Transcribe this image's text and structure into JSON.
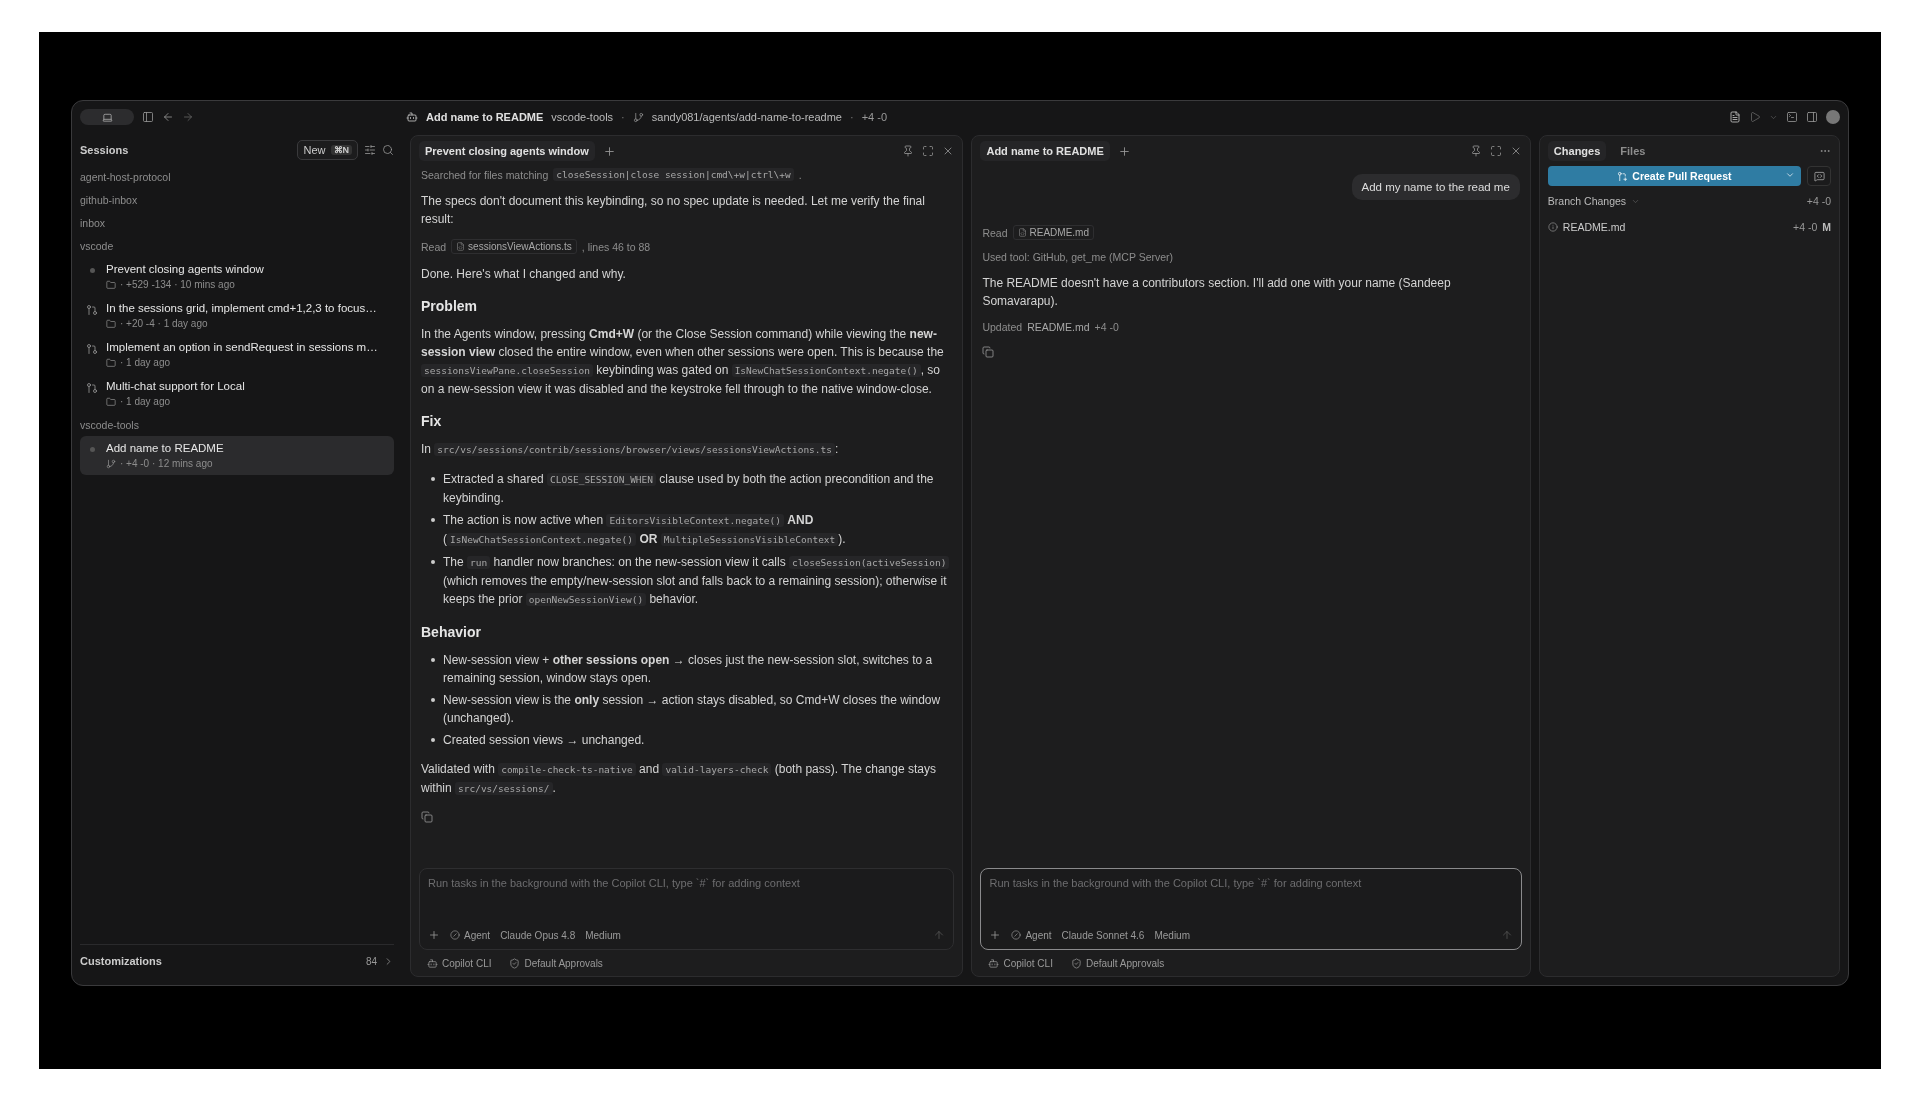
{
  "titlebar": {
    "title": "Add name to README",
    "repo": "vscode-tools",
    "separator_1": "·",
    "branch": "sandy081/agents/add-name-to-readme",
    "separator_2": "·",
    "diff": "+4 -0"
  },
  "sidebar": {
    "title": "Sessions",
    "new_button": {
      "label": "New",
      "shortcut": "⌘N"
    },
    "groups": [
      {
        "name": "agent-host-protocol"
      },
      {
        "name": "github-inbox"
      },
      {
        "name": "inbox"
      },
      {
        "name": "vscode",
        "items": [
          {
            "kind": "dot",
            "title": "Prevent closing agents window",
            "meta": {
              "kind": "folder",
              "text": "· +529 -134 · 10 mins ago"
            },
            "selected": false
          },
          {
            "kind": "pr",
            "title": "In the sessions grid, implement cmd+1,2,3 to focus…",
            "meta": {
              "kind": "folder",
              "text": "· +20 -4 · 1 day ago"
            },
            "selected": false
          },
          {
            "kind": "pr",
            "title": "Implement an option in sendRequest in sessions m…",
            "meta": {
              "kind": "folder",
              "text": "· 1 day ago"
            },
            "selected": false
          },
          {
            "kind": "pr",
            "title": "Multi-chat support for Local",
            "meta": {
              "kind": "folder",
              "text": "· 1 day ago"
            },
            "selected": false
          }
        ]
      },
      {
        "name": "vscode-tools",
        "items": [
          {
            "kind": "dot",
            "title": "Add name to README",
            "meta": {
              "kind": "branch",
              "text": "· +4 -0 · 12 mins ago"
            },
            "selected": true
          }
        ]
      }
    ],
    "footer": {
      "label": "Customizations",
      "count": "84"
    }
  },
  "chats": [
    {
      "tab": "Prevent closing agents window",
      "messages": [
        {
          "kind": "tool",
          "segments": [
            {
              "kind": "text",
              "text": "Searched for files matching"
            },
            {
              "kind": "code",
              "text": "closeSession|close session|cmd\\+w|ctrl\\+w"
            },
            {
              "kind": "text",
              "text": "."
            }
          ]
        },
        {
          "kind": "para",
          "segments": [
            {
              "kind": "text",
              "text": "The specs don't document this keybinding, so no spec update is needed. Let me verify the final result:"
            }
          ]
        },
        {
          "kind": "tool",
          "segments": [
            {
              "kind": "text",
              "text": "Read"
            },
            {
              "kind": "file",
              "text": "sessionsViewActions.ts"
            },
            {
              "kind": "text",
              "text": ", lines 46 to 88"
            }
          ]
        },
        {
          "kind": "para",
          "segments": [
            {
              "kind": "text",
              "text": "Done. Here's what I changed and why."
            }
          ]
        },
        {
          "kind": "heading",
          "text": "Problem"
        },
        {
          "kind": "para",
          "segments": [
            {
              "kind": "text",
              "text": "In the Agents window, pressing **Cmd+W** (or the Close Session command) while viewing the **new-session view** closed the entire window, even when other sessions were open. This is because the "
            },
            {
              "kind": "code",
              "text": "sessionsViewPane.closeSession"
            },
            {
              "kind": "text",
              "text": " keybinding was gated on "
            },
            {
              "kind": "code",
              "text": "IsNewChatSessionContext.negate()"
            },
            {
              "kind": "text",
              "text": ", so on a new-session view it was disabled and the keystroke fell through to the native window-close."
            }
          ]
        },
        {
          "kind": "heading",
          "text": "Fix"
        },
        {
          "kind": "para",
          "segments": [
            {
              "kind": "text",
              "text": "In "
            },
            {
              "kind": "code",
              "text": "src/vs/sessions/contrib/sessions/browser/views/sessionsViewActions.ts"
            },
            {
              "kind": "text",
              "text": ":"
            }
          ]
        },
        {
          "kind": "list",
          "items": [
            [
              {
                "kind": "text",
                "text": "Extracted a shared "
              },
              {
                "kind": "code",
                "text": "CLOSE_SESSION_WHEN"
              },
              {
                "kind": "text",
                "text": " clause used by both the action precondition and the keybinding."
              }
            ],
            [
              {
                "kind": "text",
                "text": "The action is now active when "
              },
              {
                "kind": "code",
                "text": "EditorsVisibleContext.negate()"
              },
              {
                "kind": "text",
                "text": " **AND** ("
              },
              {
                "kind": "code",
                "text": "IsNewChatSessionContext.negate()"
              },
              {
                "kind": "text",
                "text": " **OR** "
              },
              {
                "kind": "code",
                "text": "MultipleSessionsVisibleContext"
              },
              {
                "kind": "text",
                "text": ")."
              }
            ],
            [
              {
                "kind": "text",
                "text": "The "
              },
              {
                "kind": "code",
                "text": "run"
              },
              {
                "kind": "text",
                "text": " handler now branches: on the new-session view it calls "
              },
              {
                "kind": "code",
                "text": "closeSession(activeSession)"
              },
              {
                "kind": "text",
                "text": " (which removes the empty/new-session slot and falls back to a remaining session); otherwise it keeps the prior "
              },
              {
                "kind": "code",
                "text": "openNewSessionView()"
              },
              {
                "kind": "text",
                "text": " behavior."
              }
            ]
          ]
        },
        {
          "kind": "heading",
          "text": "Behavior"
        },
        {
          "kind": "list",
          "items": [
            [
              {
                "kind": "text",
                "text": "New-session view + **other sessions open** → closes just the new-session slot, switches to a remaining session, window stays open."
              }
            ],
            [
              {
                "kind": "text",
                "text": "New-session view is the **only** session → action stays disabled, so Cmd+W closes the window (unchanged)."
              }
            ],
            [
              {
                "kind": "text",
                "text": "Created session views → unchanged."
              }
            ]
          ]
        },
        {
          "kind": "para",
          "segments": [
            {
              "kind": "text",
              "text": "Validated with "
            },
            {
              "kind": "code",
              "text": "compile-check-ts-native"
            },
            {
              "kind": "text",
              "text": " and "
            },
            {
              "kind": "code",
              "text": "valid-layers-check"
            },
            {
              "kind": "text",
              "text": " (both pass). The change stays within "
            },
            {
              "kind": "code",
              "text": "src/vs/sessions/"
            },
            {
              "kind": "text",
              "text": "."
            }
          ]
        },
        {
          "kind": "copy"
        }
      ],
      "composer": {
        "placeholder": "Run tasks in the background with the Copilot CLI, type `#` for adding context",
        "mode": "Agent",
        "model": "Claude Opus 4.8",
        "effort": "Medium",
        "focused": false
      },
      "footer": {
        "agent": "Copilot CLI",
        "approvals": "Default Approvals"
      }
    },
    {
      "tab": "Add name to README",
      "messages": [
        {
          "kind": "user",
          "text": "Add my name to the read me"
        },
        {
          "kind": "tool",
          "segments": [
            {
              "kind": "text",
              "text": "Read"
            },
            {
              "kind": "file",
              "text": "README.md"
            }
          ]
        },
        {
          "kind": "tool",
          "segments": [
            {
              "kind": "text",
              "text": "Used tool: GitHub, get_me (MCP Server)"
            }
          ]
        },
        {
          "kind": "para",
          "segments": [
            {
              "kind": "text",
              "text": "The README doesn't have a contributors section. I'll add one with your name (Sandeep Somavarapu)."
            }
          ]
        },
        {
          "kind": "tool",
          "segments": [
            {
              "kind": "text",
              "text": "Updated"
            },
            {
              "kind": "link",
              "text": "README.md"
            },
            {
              "kind": "text",
              "text": "+4 -0"
            }
          ]
        },
        {
          "kind": "copy"
        }
      ],
      "composer": {
        "placeholder": "Run tasks in the background with the Copilot CLI, type `#` for adding context",
        "mode": "Agent",
        "model": "Claude Sonnet 4.6",
        "effort": "Medium",
        "focused": true
      },
      "footer": {
        "agent": "Copilot CLI",
        "approvals": "Default Approvals"
      }
    }
  ],
  "changes": {
    "tabs": [
      {
        "label": "Changes",
        "selected": true
      },
      {
        "label": "Files",
        "selected": false
      }
    ],
    "button": "Create Pull Request",
    "section": "Branch Changes",
    "section_diff": "+4 -0",
    "files": [
      {
        "name": "README.md",
        "diff": "+4 -0",
        "status": "M"
      }
    ]
  }
}
